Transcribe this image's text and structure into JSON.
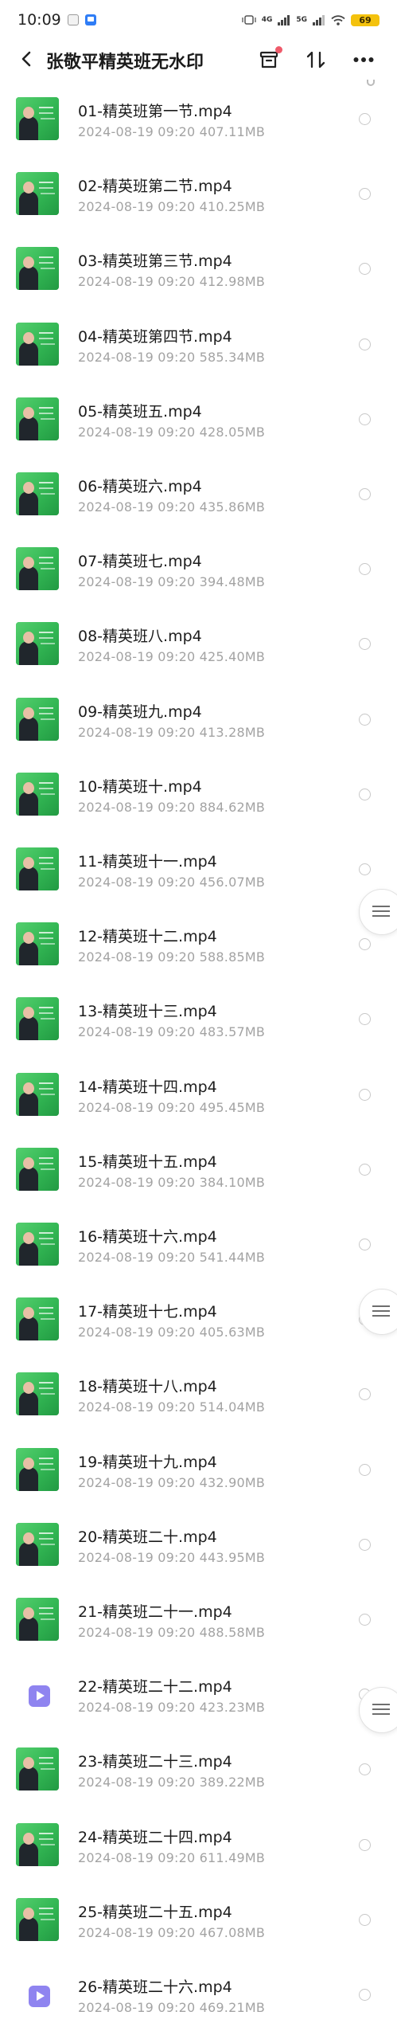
{
  "status_bar": {
    "time": "10:09",
    "net_labels": [
      "4G",
      "5G"
    ],
    "battery": "69",
    "battery_color": "#f4c20d"
  },
  "header": {
    "title": "张敬平精英班无水印",
    "back_icon": "chevron-left-icon",
    "archive_icon": "archive-box-icon",
    "sort_icon": "sort-arrows-icon",
    "more_icon": "more-dots-icon",
    "badge_color": "#ef5a6a"
  },
  "files": [
    {
      "name": "01-精英班第一节.mp4",
      "meta": "2024-08-19  09:20  407.11MB",
      "thumb": "video-thumbnail"
    },
    {
      "name": "02-精英班第二节.mp4",
      "meta": "2024-08-19  09:20  410.25MB",
      "thumb": "video-thumbnail"
    },
    {
      "name": "03-精英班第三节.mp4",
      "meta": "2024-08-19  09:20  412.98MB",
      "thumb": "video-thumbnail"
    },
    {
      "name": "04-精英班第四节.mp4",
      "meta": "2024-08-19  09:20  585.34MB",
      "thumb": "video-thumbnail"
    },
    {
      "name": "05-精英班五.mp4",
      "meta": "2024-08-19  09:20  428.05MB",
      "thumb": "video-thumbnail"
    },
    {
      "name": "06-精英班六.mp4",
      "meta": "2024-08-19  09:20  435.86MB",
      "thumb": "video-thumbnail"
    },
    {
      "name": "07-精英班七.mp4",
      "meta": "2024-08-19  09:20  394.48MB",
      "thumb": "video-thumbnail"
    },
    {
      "name": "08-精英班八.mp4",
      "meta": "2024-08-19  09:20  425.40MB",
      "thumb": "video-thumbnail"
    },
    {
      "name": "09-精英班九.mp4",
      "meta": "2024-08-19  09:20  413.28MB",
      "thumb": "video-thumbnail"
    },
    {
      "name": "10-精英班十.mp4",
      "meta": "2024-08-19  09:20  884.62MB",
      "thumb": "video-thumbnail"
    },
    {
      "name": "11-精英班十一.mp4",
      "meta": "2024-08-19  09:20  456.07MB",
      "thumb": "video-thumbnail"
    },
    {
      "name": "12-精英班十二.mp4",
      "meta": "2024-08-19  09:20  588.85MB",
      "thumb": "video-thumbnail"
    },
    {
      "name": "13-精英班十三.mp4",
      "meta": "2024-08-19  09:20  483.57MB",
      "thumb": "video-thumbnail"
    },
    {
      "name": "14-精英班十四.mp4",
      "meta": "2024-08-19  09:20  495.45MB",
      "thumb": "video-thumbnail"
    },
    {
      "name": "15-精英班十五.mp4",
      "meta": "2024-08-19  09:20  384.10MB",
      "thumb": "video-thumbnail"
    },
    {
      "name": "16-精英班十六.mp4",
      "meta": "2024-08-19  09:20  541.44MB",
      "thumb": "video-thumbnail"
    },
    {
      "name": "17-精英班十七.mp4",
      "meta": "2024-08-19  09:20  405.63MB",
      "thumb": "video-thumbnail"
    },
    {
      "name": "18-精英班十八.mp4",
      "meta": "2024-08-19  09:20  514.04MB",
      "thumb": "video-thumbnail"
    },
    {
      "name": "19-精英班十九.mp4",
      "meta": "2024-08-19  09:20  432.90MB",
      "thumb": "video-thumbnail"
    },
    {
      "name": "20-精英班二十.mp4",
      "meta": "2024-08-19  09:20  443.95MB",
      "thumb": "video-thumbnail"
    },
    {
      "name": "21-精英班二十一.mp4",
      "meta": "2024-08-19  09:20  488.58MB",
      "thumb": "video-thumbnail"
    },
    {
      "name": "22-精英班二十二.mp4",
      "meta": "2024-08-19  09:20  423.23MB",
      "thumb": "play-icon"
    },
    {
      "name": "23-精英班二十三.mp4",
      "meta": "2024-08-19  09:20  389.22MB",
      "thumb": "video-thumbnail"
    },
    {
      "name": "24-精英班二十四.mp4",
      "meta": "2024-08-19  09:20  611.49MB",
      "thumb": "video-thumbnail"
    },
    {
      "name": "25-精英班二十五.mp4",
      "meta": "2024-08-19  09:20  467.08MB",
      "thumb": "video-thumbnail"
    },
    {
      "name": "26-精英班二十六.mp4",
      "meta": "2024-08-19  09:20  469.21MB",
      "thumb": "play-icon"
    }
  ],
  "side_handles": [
    "menu-handle-icon",
    "menu-handle-icon",
    "menu-handle-icon"
  ],
  "colors": {
    "thumb_green": "#32b653",
    "play_icon": "#8f84f0",
    "meta_gray": "#a3a3a3"
  }
}
